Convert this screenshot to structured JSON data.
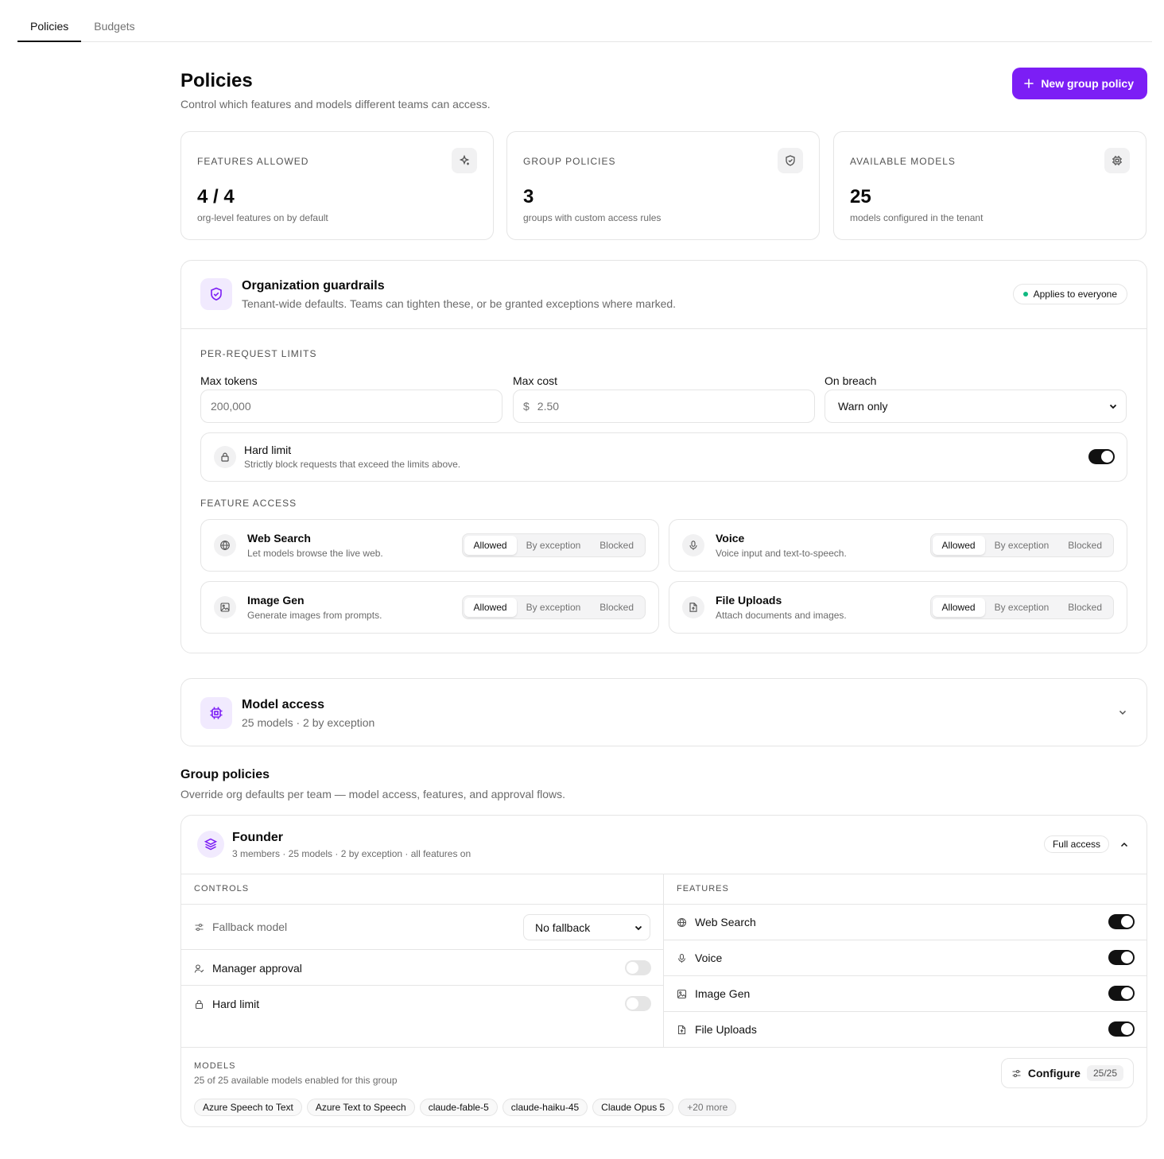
{
  "tabs": [
    {
      "label": "Policies",
      "active": true
    },
    {
      "label": "Budgets",
      "active": false
    }
  ],
  "header": {
    "title": "Policies",
    "subtitle": "Control which features and models different teams can access.",
    "new_button": "New group policy"
  },
  "stats": [
    {
      "label": "FEATURES ALLOWED",
      "value": "4 / 4",
      "desc": "org-level features on by default",
      "icon": "sparkle-icon"
    },
    {
      "label": "GROUP POLICIES",
      "value": "3",
      "desc": "groups with custom access rules",
      "icon": "shield-icon"
    },
    {
      "label": "AVAILABLE MODELS",
      "value": "25",
      "desc": "models configured in the tenant",
      "icon": "cpu-icon"
    }
  ],
  "guardrails": {
    "title": "Organization guardrails",
    "subtitle": "Tenant-wide defaults. Teams can tighten these, or be granted exceptions where marked.",
    "badge": "Applies to everyone",
    "limits_label": "PER-REQUEST LIMITS",
    "max_tokens_label": "Max tokens",
    "max_tokens_placeholder": "200,000",
    "max_cost_label": "Max cost",
    "max_cost_prefix": "$",
    "max_cost_placeholder": "2.50",
    "on_breach_label": "On breach",
    "on_breach_value": "Warn only",
    "hard_limit_title": "Hard limit",
    "hard_limit_desc": "Strictly block requests that exceed the limits above.",
    "hard_limit_on": true,
    "feature_label": "FEATURE ACCESS",
    "segment_options": [
      "Allowed",
      "By exception",
      "Blocked"
    ],
    "features": [
      {
        "name": "Web Search",
        "desc": "Let models browse the live web.",
        "selected": "Allowed",
        "icon": "globe-icon"
      },
      {
        "name": "Voice",
        "desc": "Voice input and text-to-speech.",
        "selected": "Allowed",
        "icon": "mic-icon"
      },
      {
        "name": "Image Gen",
        "desc": "Generate images from prompts.",
        "selected": "Allowed",
        "icon": "image-icon"
      },
      {
        "name": "File Uploads",
        "desc": "Attach documents and images.",
        "selected": "Allowed",
        "icon": "file-upload-icon"
      }
    ]
  },
  "model_access": {
    "title": "Model access",
    "subtitle": "25 models · 2 by exception"
  },
  "group_policies": {
    "title": "Group policies",
    "subtitle": "Override org defaults per team — model access, features, and approval flows.",
    "founder": {
      "name": "Founder",
      "meta": "3 members · 25 models · 2 by exception · all features on",
      "badge": "Full access",
      "controls_label": "CONTROLS",
      "features_label": "FEATURES",
      "fallback_label": "Fallback model",
      "fallback_value": "No fallback",
      "manager_approval_label": "Manager approval",
      "manager_approval_on": false,
      "hard_limit_label": "Hard limit",
      "hard_limit_on": false,
      "features": [
        {
          "name": "Web Search",
          "on": true,
          "icon": "globe-icon"
        },
        {
          "name": "Voice",
          "on": true,
          "icon": "mic-icon"
        },
        {
          "name": "Image Gen",
          "on": true,
          "icon": "image-icon"
        },
        {
          "name": "File Uploads",
          "on": true,
          "icon": "file-upload-icon"
        }
      ],
      "models_label": "MODELS",
      "models_desc": "25 of 25 available models enabled for this group",
      "models": [
        "Azure Speech to Text",
        "Azure Text to Speech",
        "claude-fable-5",
        "claude-haiku-45",
        "Claude Opus 5"
      ],
      "more_label": "+20 more",
      "configure_label": "Configure",
      "configure_count": "25/25"
    }
  },
  "colors": {
    "accent": "#7c1ef5",
    "accent_soft": "#f1eafe",
    "success": "#10b981",
    "border": "#e5e5e5"
  }
}
